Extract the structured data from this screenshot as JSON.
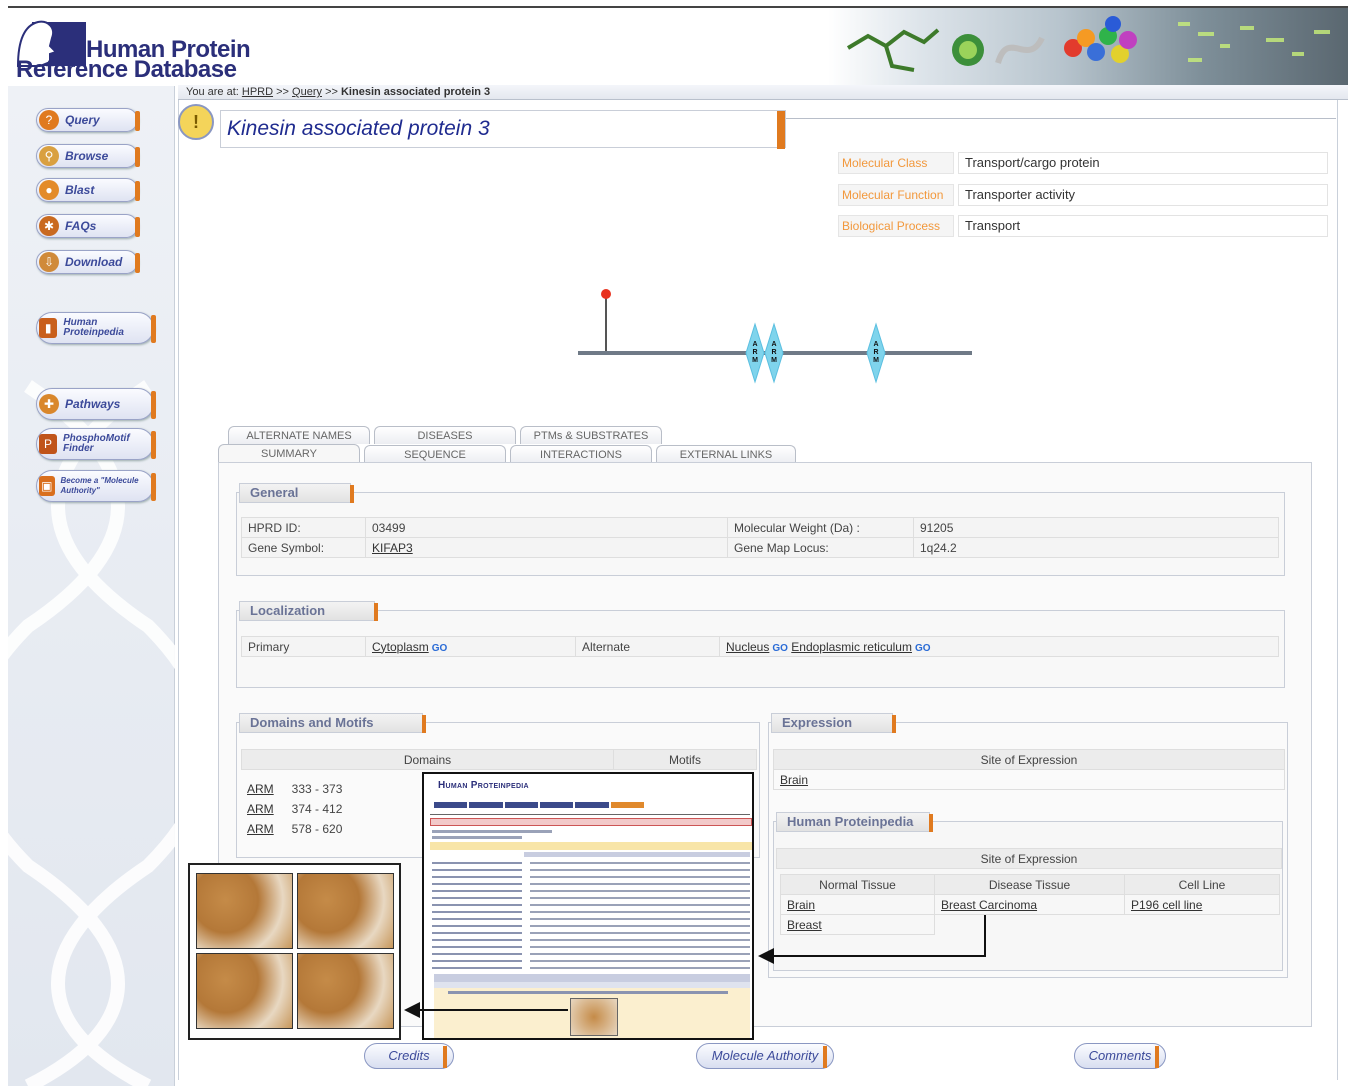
{
  "header": {
    "logo_line1": "Human Protein",
    "logo_line2": "Reference Database"
  },
  "sidebar": {
    "items": [
      {
        "label": "Query",
        "icon": "query-icon"
      },
      {
        "label": "Browse",
        "icon": "magnifier-icon"
      },
      {
        "label": "Blast",
        "icon": "blast-icon"
      },
      {
        "label": "FAQs",
        "icon": "faq-icon"
      },
      {
        "label": "Download",
        "icon": "download-icon"
      },
      {
        "label": "Human Proteinpedia",
        "icon": "book-icon"
      },
      {
        "label": "Pathways",
        "icon": "pathways-icon"
      },
      {
        "label": "PhosphoMotif Finder",
        "icon": "phosphomotif-icon"
      },
      {
        "label": "Become a \"Molecule Authority\"",
        "icon": "authority-icon"
      }
    ]
  },
  "breadcrumb": {
    "prefix": "You are at:",
    "hprd": "HPRD",
    "sep1": ">>",
    "query": "Query",
    "sep2": ">>",
    "current": "Kinesin associated protein 3"
  },
  "protein": {
    "title": "Kinesin associated protein 3",
    "molecular_class_label": "Molecular Class",
    "molecular_class": "Transport/cargo protein",
    "molecular_function_label": "Molecular Function",
    "molecular_function": "Transporter activity",
    "biological_process_label": "Biological Process",
    "biological_process": "Transport"
  },
  "diagram": {
    "domain_label": "ARM",
    "domain_count": 3,
    "ptm_color": "#e8321f",
    "domain_color": "#7fd4ec"
  },
  "tabs": {
    "row1": [
      "ALTERNATE NAMES",
      "DISEASES",
      "PTMs & SUBSTRATES"
    ],
    "row2": [
      "SUMMARY",
      "SEQUENCE",
      "INTERACTIONS",
      "EXTERNAL LINKS"
    ]
  },
  "general": {
    "heading": "General",
    "hprd_id_label": "HPRD ID:",
    "hprd_id": "03499",
    "mw_label": "Molecular Weight (Da) :",
    "mw": "91205",
    "gene_symbol_label": "Gene Symbol:",
    "gene_symbol": "KIFAP3",
    "locus_label": "Gene Map Locus:",
    "locus": "1q24.2"
  },
  "localization": {
    "heading": "Localization",
    "primary_label": "Primary",
    "primary": "Cytoplasm",
    "alternate_label": "Alternate",
    "alternate1": "Nucleus",
    "alternate2": "Endoplasmic reticulum",
    "go": "GO"
  },
  "domains": {
    "heading": "Domains and Motifs",
    "col_domains": "Domains",
    "col_motifs": "Motifs",
    "rows": [
      {
        "name": "ARM",
        "range": "333 - 373"
      },
      {
        "name": "ARM",
        "range": "374 - 412"
      },
      {
        "name": "ARM",
        "range": "578 - 620"
      }
    ]
  },
  "expression": {
    "heading": "Expression",
    "site_header": "Site of Expression",
    "site": "Brain"
  },
  "proteinpedia": {
    "heading": "Human Proteinpedia",
    "site_header": "Site of Expression",
    "normal_header": "Normal Tissue",
    "disease_header": "Disease Tissue",
    "cell_header": "Cell Line",
    "normal1": "Brain",
    "normal2": "Breast",
    "disease1": "Breast Carcinoma",
    "cell1": "P196 cell line"
  },
  "overlay": {
    "hpp_title": "Human Proteinpedia"
  },
  "footer": {
    "credits": "Credits",
    "authority": "Molecule Authority",
    "comments": "Comments"
  }
}
